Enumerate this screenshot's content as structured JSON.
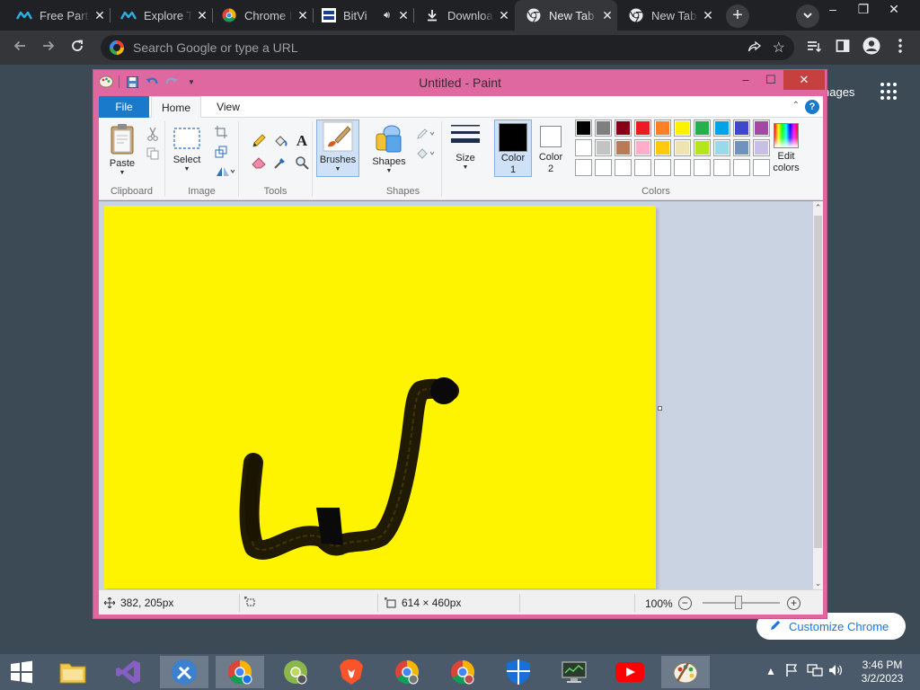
{
  "chrome": {
    "tabs": [
      {
        "title": "Free Part",
        "icon": "logo-icon",
        "active": false
      },
      {
        "title": "Explore T",
        "icon": "logo-icon",
        "active": false
      },
      {
        "title": "Chrome I",
        "icon": "chrome-icon",
        "active": false
      },
      {
        "title": "BitVi",
        "icon": "bitvise-icon",
        "active": false
      },
      {
        "title": "Downloa",
        "icon": "download-icon",
        "active": false
      },
      {
        "title": "New Tab",
        "icon": "chrome-icon",
        "active": true
      },
      {
        "title": "New Tab",
        "icon": "chrome-icon",
        "active": false
      }
    ],
    "omnibox_placeholder": "Search Google or type a URL",
    "ntp_images_label": "nages",
    "customize_label": "Customize Chrome"
  },
  "paint": {
    "title": "Untitled - Paint",
    "ribbon_tabs": [
      "File",
      "Home",
      "View"
    ],
    "groups": {
      "clipboard": "Clipboard",
      "image": "Image",
      "tools": "Tools",
      "shapes": "Shapes",
      "colors": "Colors"
    },
    "buttons": {
      "paste": "Paste",
      "select": "Select",
      "brushes": "Brushes",
      "shapes": "Shapes",
      "size": "Size",
      "color1_line1": "Color",
      "color1_line2": "1",
      "color2_line1": "Color",
      "color2_line2": "2",
      "edit_colors_line1": "Edit",
      "edit_colors_line2": "colors"
    },
    "palette_row1": [
      "#000000",
      "#7f7f7f",
      "#880015",
      "#ed1c24",
      "#ff7f27",
      "#fff200",
      "#22b14c",
      "#00a2e8",
      "#3f48cc",
      "#a349a4"
    ],
    "palette_row2": [
      "#ffffff",
      "#c3c3c3",
      "#b97a57",
      "#ffaec9",
      "#ffc90e",
      "#efe4b0",
      "#b5e61d",
      "#99d9ea",
      "#7092be",
      "#c8bfe7"
    ],
    "color1": "#000000",
    "color2": "#ffffff",
    "canvas_color": "#fff400",
    "status": {
      "cursor_pos": "382, 205px",
      "selection_size": "",
      "image_size": "614 × 460px",
      "zoom": "100%"
    }
  },
  "taskbar": {
    "time": "3:46 PM",
    "date": "3/2/2023"
  }
}
